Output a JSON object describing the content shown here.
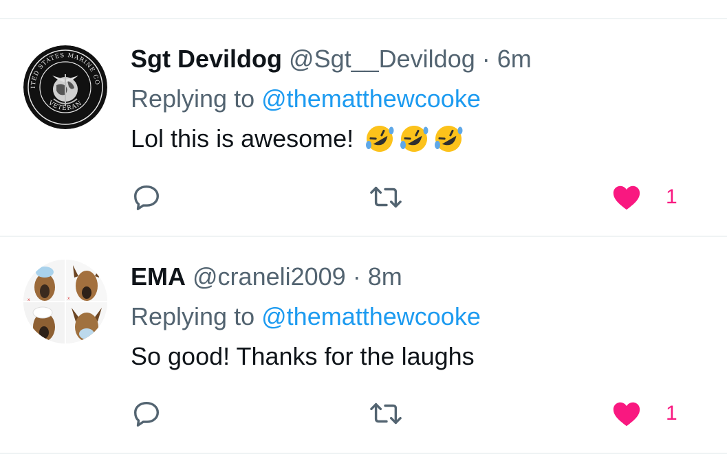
{
  "tweets": [
    {
      "display_name": "Sgt Devildog",
      "handle": "@Sgt__Devildog",
      "separator": "·",
      "time": "6m",
      "reply_prefix": "Replying to",
      "reply_to": "@thematthewcooke",
      "text": "Lol this is awesome!",
      "emojis": [
        "rolling-on-floor-laughing-emoji",
        "rolling-on-floor-laughing-emoji",
        "rolling-on-floor-laughing-emoji"
      ],
      "avatar": "marine-corps-veteran-emblem",
      "avatar_text_top": "UNITED STATES MARINE CORPS",
      "avatar_text_bottom": "VETERAN",
      "like_count": "1",
      "liked": true
    },
    {
      "display_name": "EMA",
      "handle": "@craneli2009",
      "separator": "·",
      "time": "8m",
      "reply_prefix": "Replying to",
      "reply_to": "@thematthewcooke",
      "text": "So good! Thanks for the laughs",
      "avatar": "dog-photo-grid",
      "like_count": "1",
      "liked": true
    }
  ],
  "colors": {
    "link": "#1d9bf0",
    "secondary_text": "#536471",
    "like_pink": "#f91880",
    "divider": "#eff3f4"
  },
  "icons": {
    "reply": "reply-icon",
    "retweet": "retweet-icon",
    "like": "heart-icon"
  }
}
